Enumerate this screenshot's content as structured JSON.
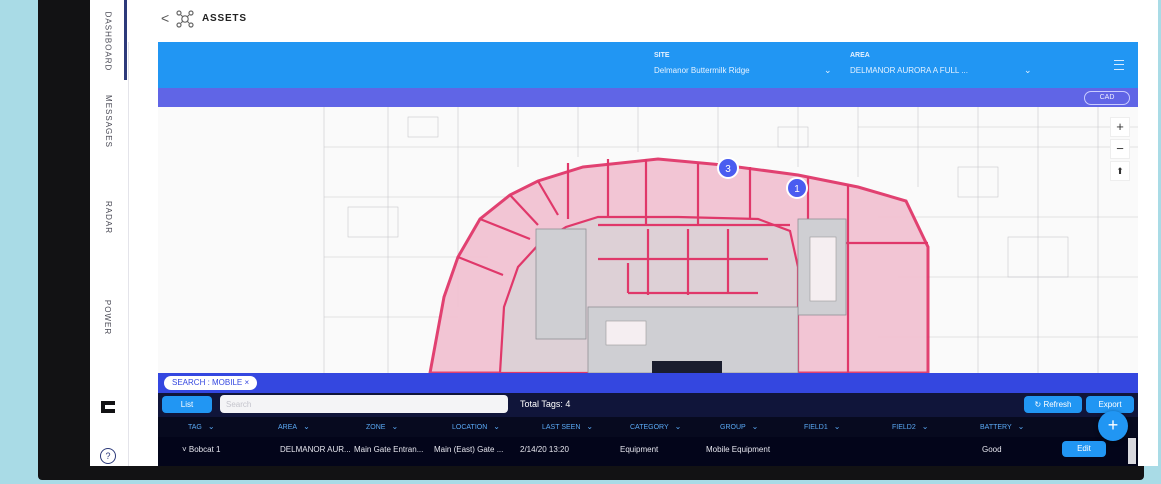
{
  "nav": {
    "tabs": [
      {
        "label": "DASHBOARD"
      },
      {
        "label": "MESSAGES"
      },
      {
        "label": "RADAR"
      },
      {
        "label": "POWER"
      }
    ],
    "help_glyph": "?"
  },
  "header": {
    "back_glyph": "<",
    "title": "ASSETS"
  },
  "toolbar": {
    "site_label": "SITE",
    "site_value": "Delmanor Buttermilk Ridge",
    "area_label": "AREA",
    "area_value": "DELMANOR AURORA A FULL ...",
    "cad_label": "CAD"
  },
  "map": {
    "cluster_1": "3",
    "cluster_2": "1"
  },
  "search": {
    "chip": "SEARCH : MOBILE  ×"
  },
  "list": {
    "list_button": "List",
    "search_placeholder": "Search",
    "total_tags": "Total Tags: 4",
    "refresh_button": "↻ Refresh",
    "export_button": "Export",
    "columns": [
      "TAG",
      "AREA",
      "ZONE",
      "LOCATION",
      "LAST SEEN",
      "CATEGORY",
      "GROUP",
      "FIELD1",
      "FIELD2",
      "BATTERY"
    ],
    "rows": [
      {
        "tag": "˅ Bobcat 1",
        "area": "DELMANOR AUR...",
        "zone": "Main Gate Entran...",
        "location": "Main (East) Gate ...",
        "last_seen": "2/14/20 13:20",
        "category": "Equipment",
        "group": "Mobile Equipment",
        "battery": "Good",
        "edit": "Edit"
      }
    ],
    "fab_glyph": "+"
  },
  "colors": {
    "toolbar": "#2196f3",
    "accent_bar": "#6065e6",
    "search_strip": "#3447e0",
    "table_bg": "#10153a",
    "zone_outline": "#e0386a"
  }
}
